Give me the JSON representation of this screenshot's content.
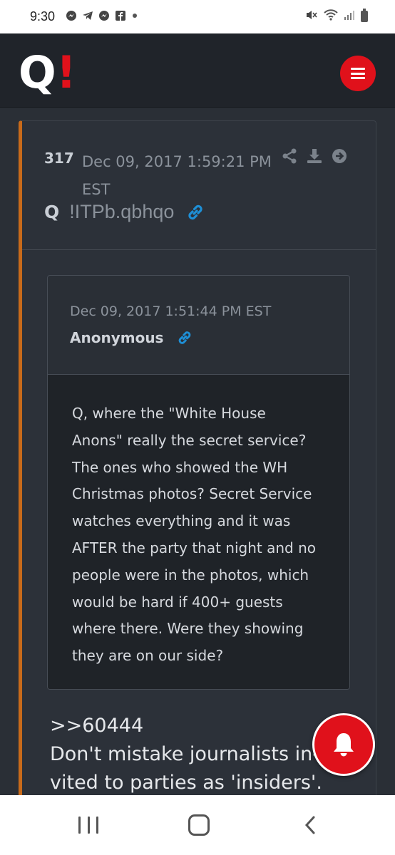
{
  "status_bar": {
    "time": "9:30",
    "notification_icons": [
      "messenger-icon",
      "telegram-icon",
      "messenger-icon",
      "facebook-icon",
      "dot-icon"
    ],
    "right_icons": [
      "mute-icon",
      "wifi-icon",
      "signal-icon",
      "battery-icon"
    ]
  },
  "header": {
    "logo_letter": "Q",
    "logo_mark": "!",
    "menu_icon": "hamburger-icon"
  },
  "post": {
    "number": "317",
    "date": "Dec 09, 2017 1:59:21 PM EST",
    "author": "Q",
    "tripcode": "!ITPb.qbhqo",
    "actions": [
      "share-icon",
      "download-icon",
      "forward-icon"
    ],
    "accent_color": "#c86a1a"
  },
  "quote": {
    "date": "Dec 09, 2017 1:51:44 PM EST",
    "author": "Anonymous",
    "text": "Q, where the \"White House\nAnons\" really the secret service?\nThe ones who showed the WH\nChristmas photos?  Secret Service\nwatches everything and it was\nAFTER the party that night and no\npeople were in the photos, which\nwould be hard if 400+ guests\nwhere there.  Were they showing\nthey are on our side?"
  },
  "reply": {
    "text": ">>60444\nDon't mistake journalists in-\nvited to parties as 'insiders'."
  },
  "colors": {
    "brand_red": "#e0111b",
    "link_blue": "#1e8fd6"
  }
}
